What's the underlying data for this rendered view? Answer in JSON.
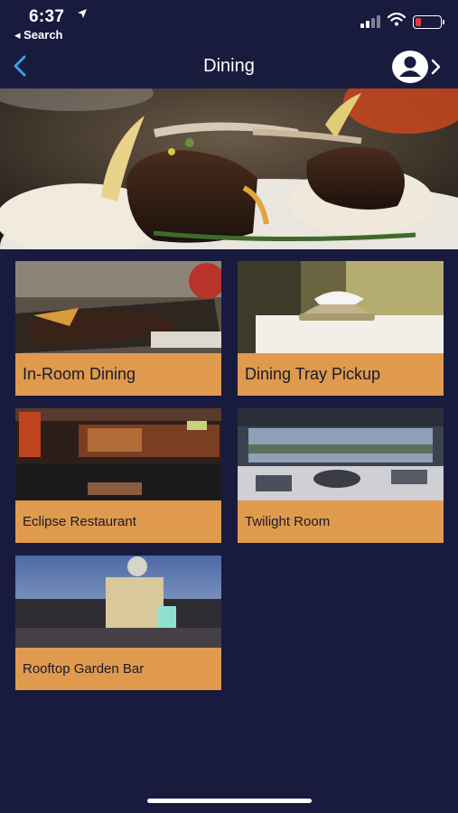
{
  "status": {
    "time": "6:37",
    "back_label": "◂ Search",
    "battery_color": "#e23b3b",
    "icons": [
      "location-arrow-icon",
      "signal-icon",
      "wifi-icon",
      "battery-icon"
    ]
  },
  "nav": {
    "title": "Dining",
    "back_icon": "chevron-left-icon",
    "profile_icon": "user-icon",
    "forward_icon": "chevron-right-icon"
  },
  "colors": {
    "background": "#181a3e",
    "card_label_bg": "#df9a4e",
    "card_label_text": "#1a1a2a",
    "accent": "#3aa0e8"
  },
  "cards": [
    {
      "label": "In-Room Dining"
    },
    {
      "label": "Dining Tray Pickup"
    },
    {
      "label": "Eclipse Restaurant"
    },
    {
      "label": "Twilight Room"
    },
    {
      "label": "Rooftop Garden Bar"
    }
  ]
}
